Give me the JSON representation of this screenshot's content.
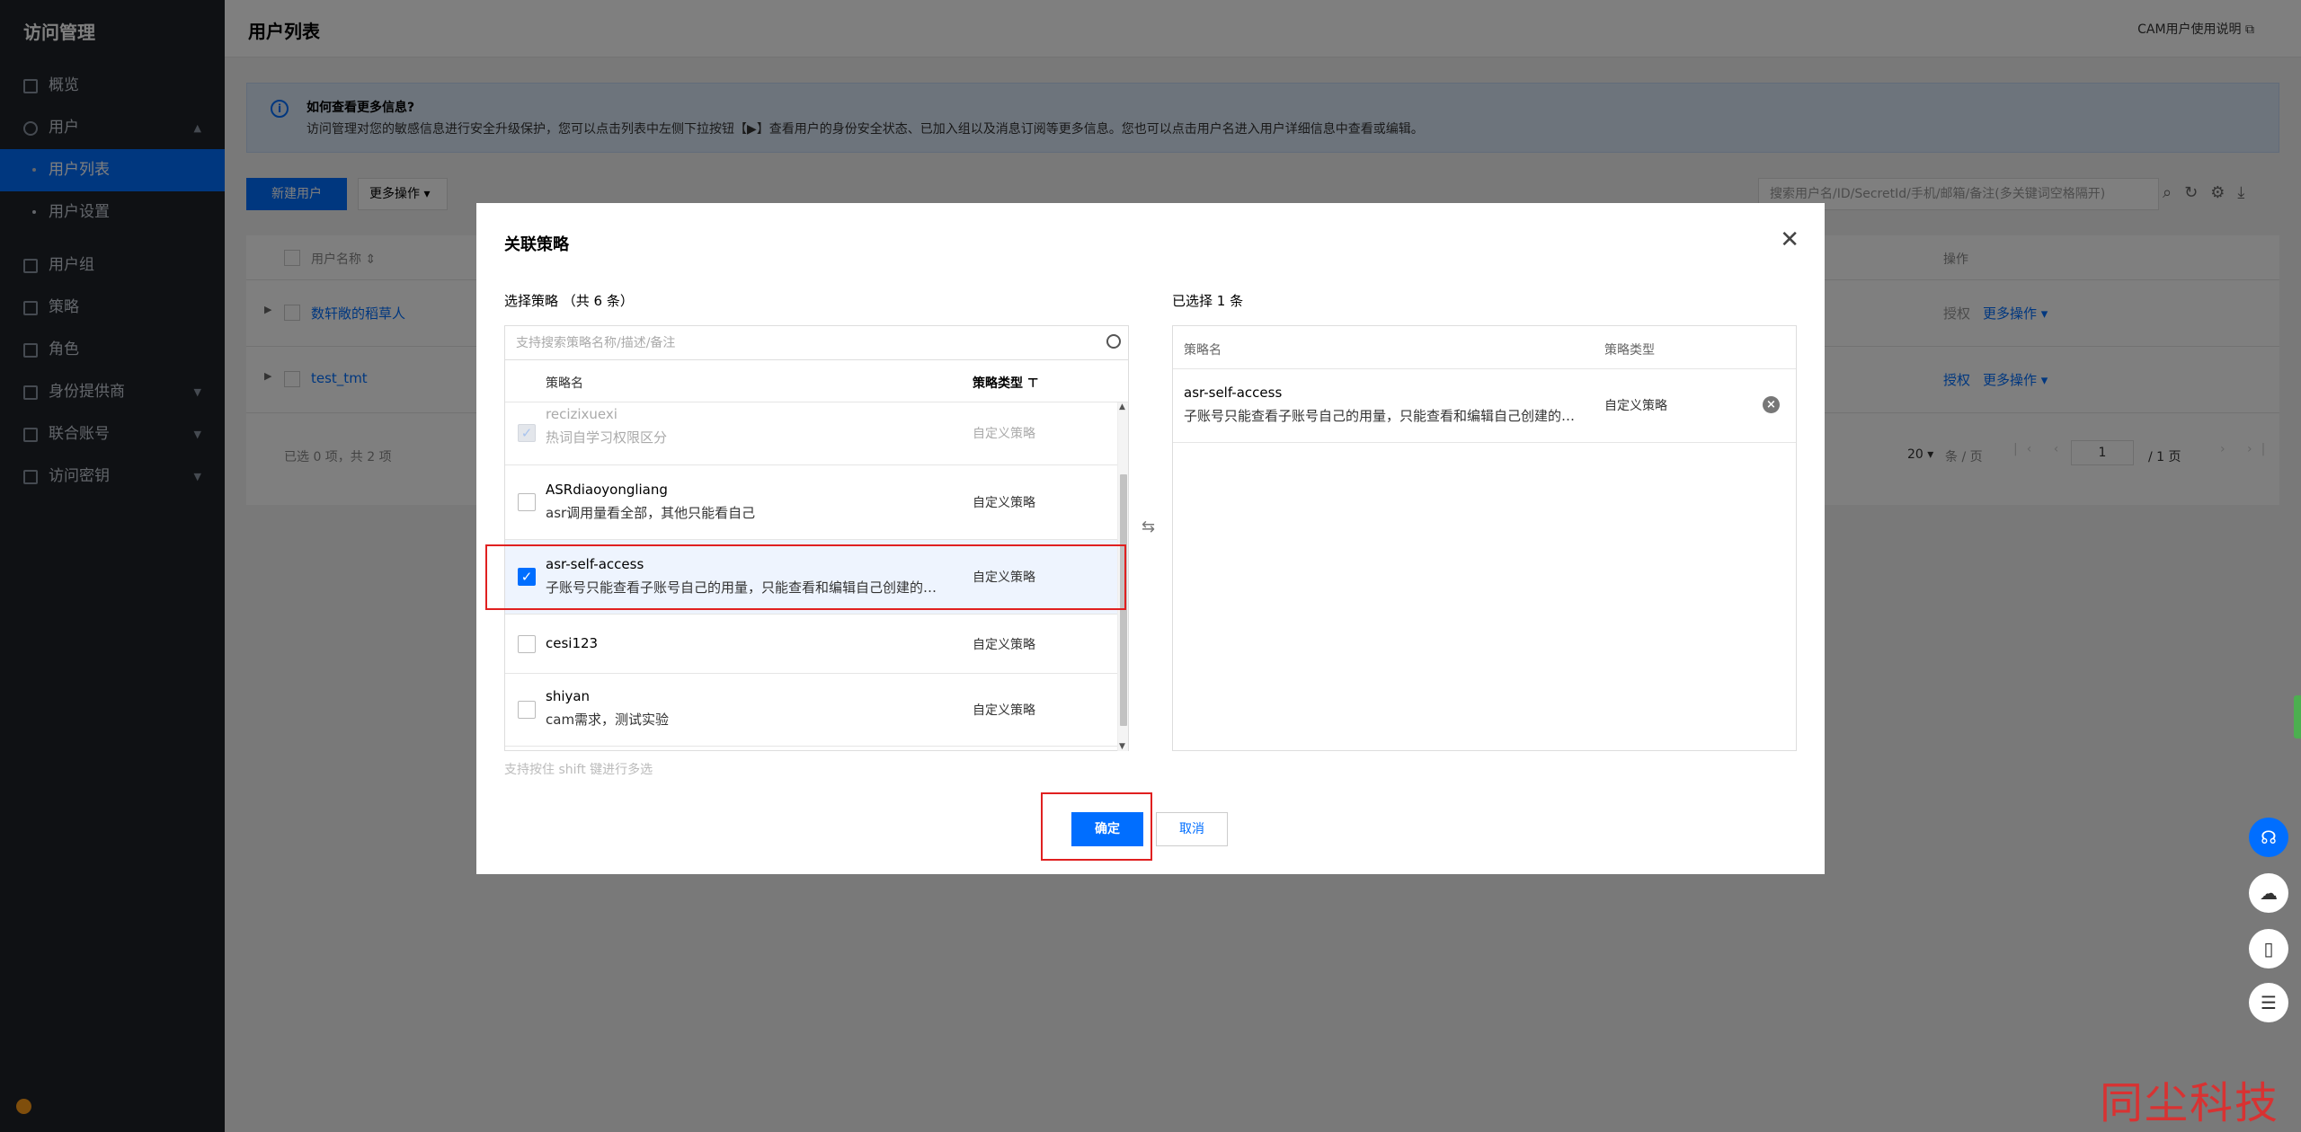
{
  "sidebar": {
    "title": "访问管理",
    "items": [
      {
        "label": "概览",
        "icon": "dashboard-icon"
      },
      {
        "label": "用户",
        "icon": "user-icon",
        "expanded": true
      }
    ],
    "sub_items": [
      {
        "label": "用户列表",
        "active": true
      },
      {
        "label": "用户设置",
        "active": false
      }
    ],
    "items2": [
      {
        "label": "用户组",
        "icon": "group-icon"
      },
      {
        "label": "策略",
        "icon": "policy-icon"
      },
      {
        "label": "角色",
        "icon": "role-icon"
      },
      {
        "label": "身份提供商",
        "icon": "idp-icon"
      },
      {
        "label": "联合账号",
        "icon": "federation-icon"
      },
      {
        "label": "访问密钥",
        "icon": "key-icon"
      }
    ]
  },
  "header": {
    "page_title": "用户列表",
    "cam_link": "CAM用户使用说明 ⧉"
  },
  "notice": {
    "title": "如何查看更多信息?",
    "desc": "访问管理对您的敏感信息进行安全升级保护，您可以点击列表中左侧下拉按钮【▶】查看用户的身份安全状态、已加入组以及消息订阅等更多信息。您也可以点击用户名进入用户详细信息中查看或编辑。"
  },
  "toolbar": {
    "new_user": "新建用户",
    "more_ops": "更多操作 ▾",
    "search_placeholder": "搜索用户名/ID/SecretId/手机/邮箱/备注(多关键词空格隔开)"
  },
  "table": {
    "col_name": "用户名称 ⇕",
    "col_ops": "操作",
    "rows": [
      {
        "name": "数轩敞的稻草人",
        "auth": "授权",
        "more": "更多操作 ▾"
      },
      {
        "name": "test_tmt",
        "auth": "授权",
        "more": "更多操作 ▾"
      }
    ],
    "selected_info": "已选 0 项，共 2 项",
    "page_size": "20 ▾",
    "per_page": "条 / 页",
    "page_value": "1",
    "page_total": "/ 1 页"
  },
  "modal": {
    "title": "关联策略",
    "left_label": "选择策略  （共 6 条）",
    "right_label": "已选择 1 条",
    "search_placeholder": "支持搜索策略名称/描述/备注",
    "col_name": "策略名",
    "col_type": "策略类型 ⊤",
    "policies": [
      {
        "name": "recizixuexi",
        "desc": "热词自学习权限区分",
        "type": "自定义策略",
        "state": "disabled-checked"
      },
      {
        "name": "ASRdiaoyongliang",
        "desc": "asr调用量看全部，其他只能看自己",
        "type": "自定义策略",
        "state": "unchecked"
      },
      {
        "name": "asr-self-access",
        "desc": "子账号只能查看子账号自己的用量，只能查看和编辑自己创建的热词表和自学习模型",
        "type": "自定义策略",
        "state": "checked"
      },
      {
        "name": "cesi123",
        "desc": "",
        "type": "自定义策略",
        "state": "unchecked"
      },
      {
        "name": "shiyan",
        "desc": "cam需求，测试实验",
        "type": "自定义策略",
        "state": "unchecked"
      }
    ],
    "hint": "支持按住 shift 键进行多选",
    "right_col_name": "策略名",
    "right_col_type": "策略类型",
    "selected": [
      {
        "name": "asr-self-access",
        "desc": "子账号只能查看子账号自己的用量，只能查看和编辑自己创建的热词表和自学习模型",
        "type": "自定义策略"
      }
    ],
    "ok": "确定",
    "cancel": "取消",
    "swap_icon": "⇆"
  },
  "watermark": "同尘科技",
  "colors": {
    "accent": "#006eff",
    "highlight": "#e02020",
    "sidebar": "#1f2329"
  }
}
